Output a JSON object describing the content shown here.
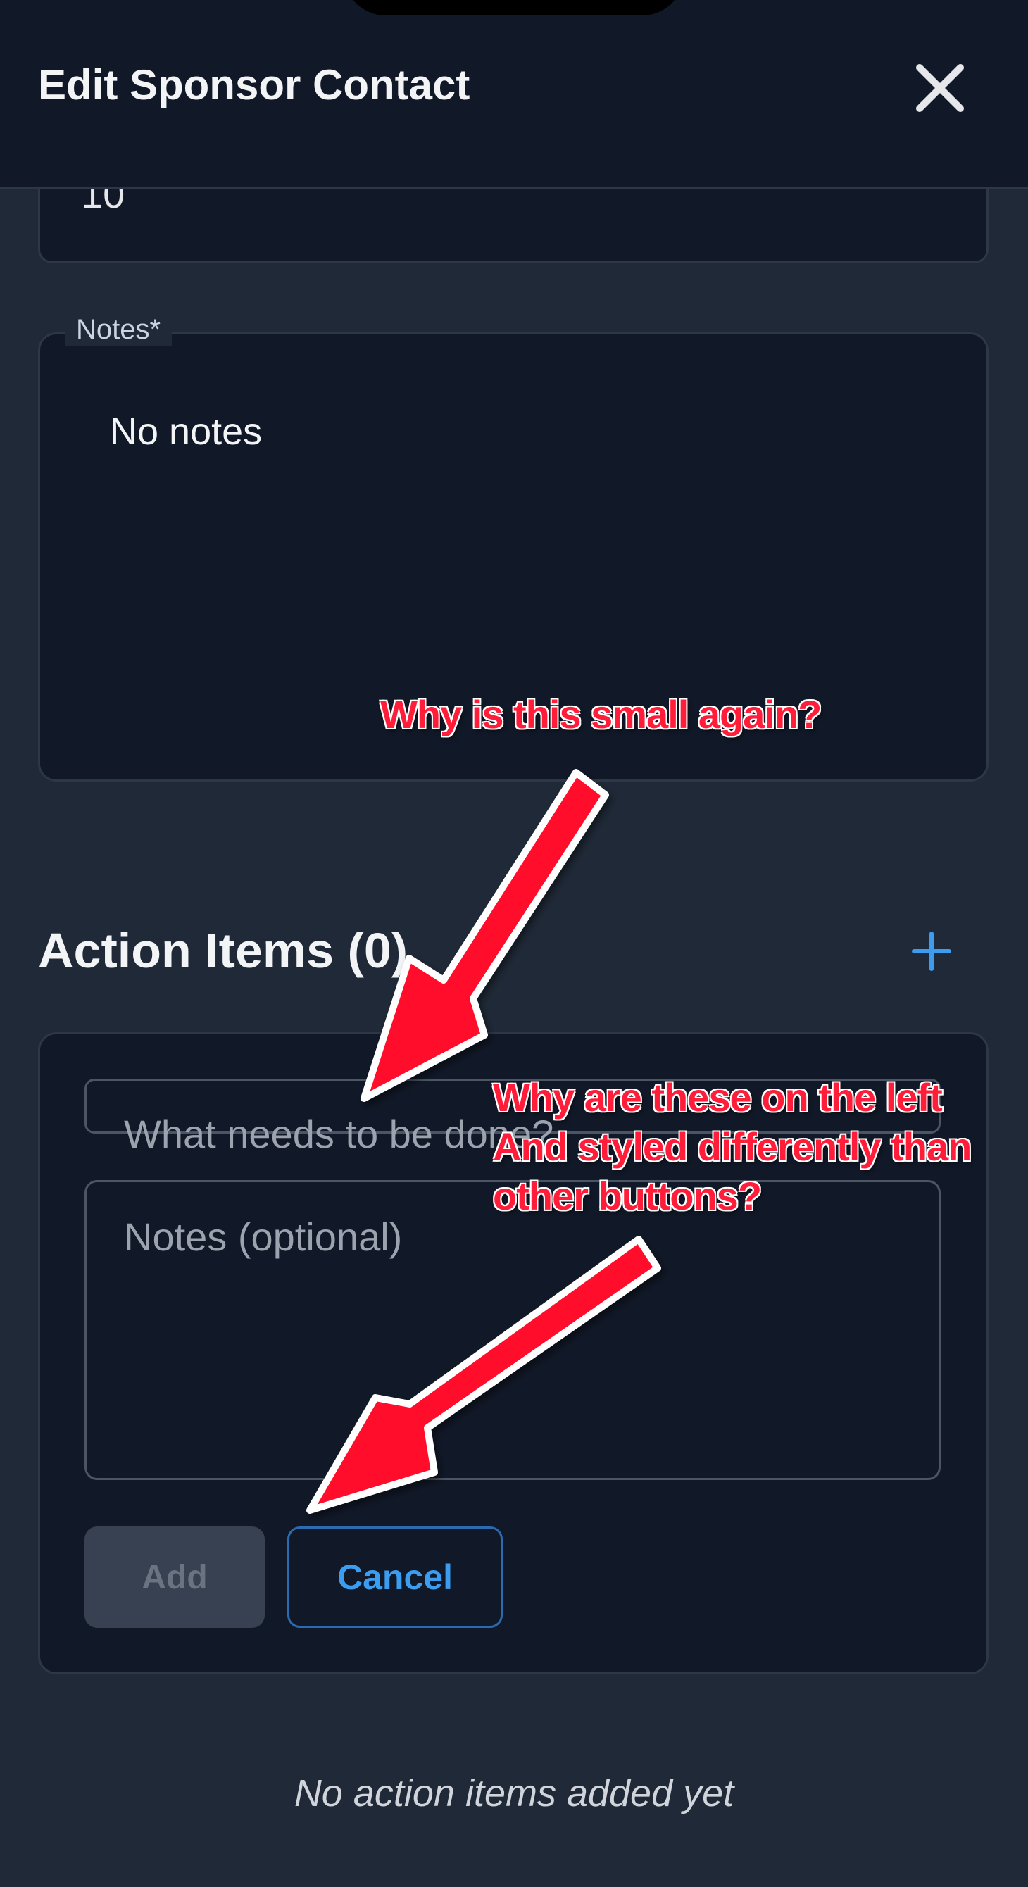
{
  "header": {
    "title": "Edit Sponsor Contact",
    "close_icon": "close-icon"
  },
  "previous_field": {
    "value": "10"
  },
  "notes_field": {
    "label": "Notes*",
    "value": "No notes"
  },
  "action_items": {
    "title": "Action Items (0)",
    "add_icon": "plus-icon",
    "form": {
      "task_placeholder": "What needs to be done?",
      "notes_placeholder": "Notes (optional)",
      "add_label": "Add",
      "cancel_label": "Cancel"
    },
    "empty_text": "No action items added yet"
  },
  "annotations": {
    "note_1": "Why is this small again?",
    "note_2_lines": [
      "Why are these on the left",
      "And styled differently than",
      "other buttons?"
    ],
    "color": "#ff1d3a"
  },
  "colors": {
    "background": "#1f2937",
    "surface": "#111827",
    "accent": "#3b9cf0",
    "annotation": "#ff1d3a"
  }
}
